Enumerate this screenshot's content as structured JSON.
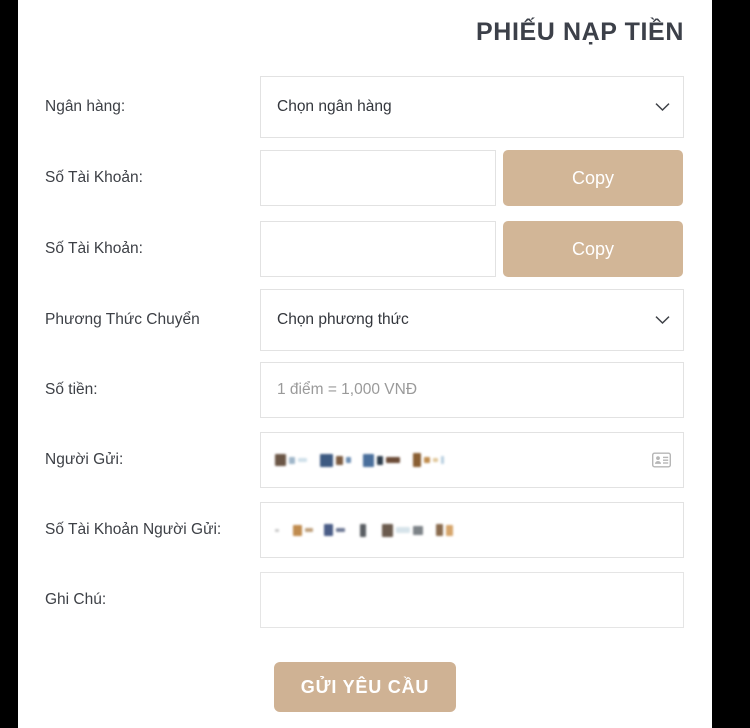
{
  "page": {
    "title": "PHIẾU NẠP TIỀN",
    "accent_color": "#d2b697",
    "submit_color": "#cfb294",
    "label_color": "#3d4046",
    "title_color": "#3c4049",
    "field_border_color": "#e2e2e2"
  },
  "form": {
    "bank": {
      "label": "Ngân hàng:",
      "selected": "Chọn ngân hàng",
      "icon": "chevron-down-icon"
    },
    "account_number_1": {
      "label": "Số Tài Khoản:",
      "value": "",
      "copy_label": "Copy"
    },
    "account_number_2": {
      "label": "Số Tài Khoản:",
      "value": "",
      "copy_label": "Copy"
    },
    "transfer_method": {
      "label": "Phương Thức Chuyển",
      "selected": "Chọn phương thức",
      "icon": "chevron-down-icon"
    },
    "amount": {
      "label": "Số tiền:",
      "value": "",
      "placeholder": "1 điểm = 1,000 VNĐ"
    },
    "sender_name": {
      "label": "Người Gửi:",
      "value": "",
      "redacted": true,
      "icon": "contact-card-icon"
    },
    "sender_account": {
      "label": "Số Tài Khoản Người Gửi:",
      "value": "",
      "redacted": true
    },
    "note": {
      "label": "Ghi Chú:",
      "value": ""
    }
  },
  "submit": {
    "label": "GỬI YÊU CẦU"
  },
  "redaction": {
    "sender_name_blocks": [
      {
        "w": 11,
        "h": 12,
        "c": "#6b5646"
      },
      {
        "w": 6,
        "h": 7,
        "c": "#9fb6c9"
      },
      {
        "w": 9,
        "h": 4,
        "c": "#cfe0ea"
      },
      {
        "w": 7,
        "h": 0,
        "c": "#ffffff"
      },
      {
        "w": 13,
        "h": 13,
        "c": "#3d5a82"
      },
      {
        "w": 7,
        "h": 9,
        "c": "#7d5c41"
      },
      {
        "w": 5,
        "h": 6,
        "c": "#6d8fb5"
      },
      {
        "w": 6,
        "h": 0,
        "c": "#ffffff"
      },
      {
        "w": 11,
        "h": 13,
        "c": "#4a6f9c"
      },
      {
        "w": 6,
        "h": 9,
        "c": "#2e3d4d"
      },
      {
        "w": 14,
        "h": 6,
        "c": "#6b4b37"
      },
      {
        "w": 7,
        "h": 0,
        "c": "#ffffff"
      },
      {
        "w": 8,
        "h": 14,
        "c": "#8a5f33"
      },
      {
        "w": 6,
        "h": 6,
        "c": "#c08d4e"
      },
      {
        "w": 5,
        "h": 4,
        "c": "#e0c79a"
      },
      {
        "w": 3,
        "h": 8,
        "c": "#b8cfe0"
      }
    ],
    "sender_account_blocks": [
      {
        "w": 4,
        "h": 3,
        "c": "#c9c9c9"
      },
      {
        "w": 8,
        "h": 0,
        "c": "#ffffff"
      },
      {
        "w": 9,
        "h": 11,
        "c": "#c08b4e"
      },
      {
        "w": 8,
        "h": 4,
        "c": "#bfa07c"
      },
      {
        "w": 5,
        "h": 0,
        "c": "#ffffff"
      },
      {
        "w": 9,
        "h": 12,
        "c": "#4a5d87"
      },
      {
        "w": 9,
        "h": 4,
        "c": "#6f7a96"
      },
      {
        "w": 9,
        "h": 0,
        "c": "#ffffff"
      },
      {
        "w": 6,
        "h": 13,
        "c": "#5a5e63"
      },
      {
        "w": 10,
        "h": 0,
        "c": "#ffffff"
      },
      {
        "w": 11,
        "h": 13,
        "c": "#6b5b4e"
      },
      {
        "w": 14,
        "h": 6,
        "c": "#d6e3ea"
      },
      {
        "w": 10,
        "h": 9,
        "c": "#7d8388"
      },
      {
        "w": 7,
        "h": 0,
        "c": "#ffffff"
      },
      {
        "w": 7,
        "h": 12,
        "c": "#8a6b4e"
      },
      {
        "w": 7,
        "h": 11,
        "c": "#d6a56b"
      }
    ]
  }
}
